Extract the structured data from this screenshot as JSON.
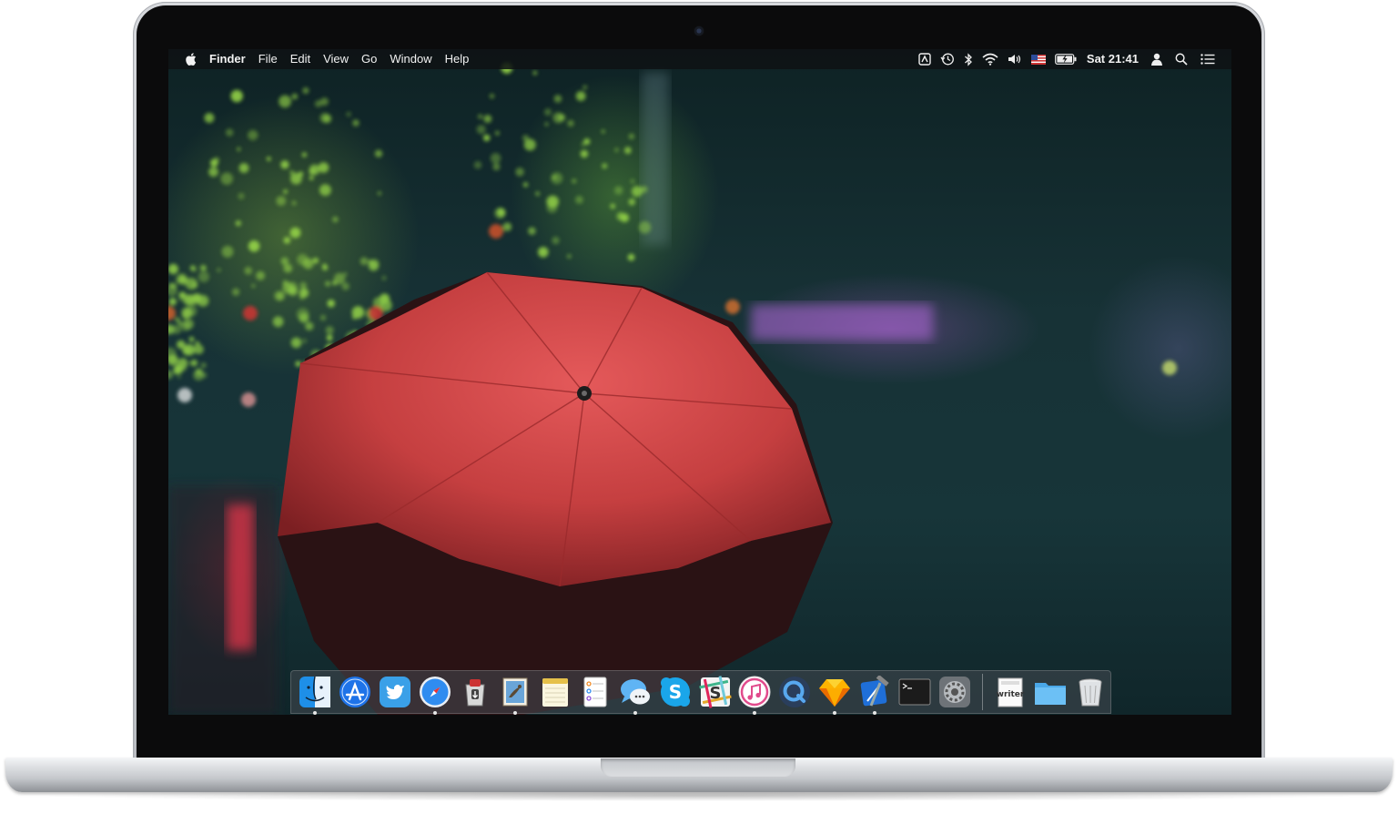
{
  "menubar": {
    "app_name": "Finder",
    "menus": [
      "File",
      "Edit",
      "View",
      "Go",
      "Window",
      "Help"
    ],
    "status_icons": [
      "app-status-icon",
      "time-machine-icon",
      "bluetooth-icon",
      "wifi-icon",
      "volume-icon",
      "us-flag-input-icon",
      "battery-charging-icon"
    ],
    "clock": "Sat 21:41",
    "extras": [
      "user-icon",
      "spotlight-search-icon",
      "notification-center-icon"
    ]
  },
  "wallpaper": {
    "description_colors": {
      "umbrella": "#c8413f",
      "bokeh_green": "#9ee04a",
      "night": "#122a2e"
    }
  },
  "dock": {
    "apps": [
      {
        "name": "finder",
        "running": true
      },
      {
        "name": "app-store",
        "running": false
      },
      {
        "name": "twitter",
        "running": false
      },
      {
        "name": "safari",
        "running": true
      },
      {
        "name": "transmit",
        "running": false
      },
      {
        "name": "mail",
        "running": true
      },
      {
        "name": "notes",
        "running": false
      },
      {
        "name": "reminders",
        "running": false
      },
      {
        "name": "messages",
        "running": true
      },
      {
        "name": "skype",
        "running": false
      },
      {
        "name": "slack",
        "running": false
      },
      {
        "name": "itunes",
        "running": true
      },
      {
        "name": "quicktime",
        "running": false
      },
      {
        "name": "sketch",
        "running": true
      },
      {
        "name": "xcode",
        "running": true
      },
      {
        "name": "terminal",
        "running": false
      },
      {
        "name": "system-preferences",
        "running": false
      }
    ],
    "stack_items": [
      {
        "name": "writer-document",
        "label": "writer"
      },
      {
        "name": "folder"
      },
      {
        "name": "trash"
      }
    ]
  }
}
